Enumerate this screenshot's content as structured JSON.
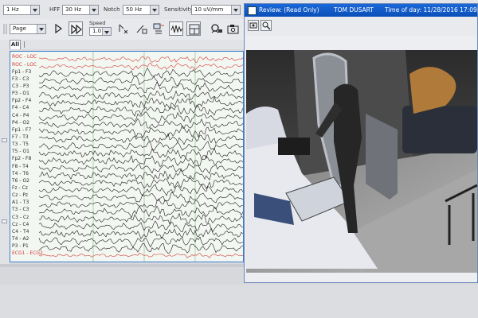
{
  "toolbar": {
    "lff": {
      "value": "1 Hz"
    },
    "hff": {
      "label": "HFF",
      "value": "30 Hz"
    },
    "notch": {
      "label": "Notch",
      "value": "50 Hz"
    },
    "sensitivity": {
      "label": "Sensitivity",
      "value": "10 uV/mm"
    }
  },
  "nav": {
    "page_label": "Page",
    "speed_label": "Speed",
    "speed_value": "1.0"
  },
  "tabs": {
    "all": "All"
  },
  "eeg": {
    "channels": [
      "ROC - LOC",
      "ROC - LOC",
      "Fp1 - F3",
      "F3 - C3",
      "C3 - P3",
      "P3 - O1",
      "Fp2 - F4",
      "F4 - C4",
      "C4 - P4",
      "P4 - O2",
      "Fp1 - F7",
      "F7 - T3",
      "T3 - T5",
      "T5 - O1",
      "Fp2 - F8",
      "F8 - T4",
      "T4 - T6",
      "T6 - O2",
      "Fz - Cz",
      "Cz - Pz",
      "A1 - T3",
      "T3 - C3",
      "C3 - Cz",
      "Cz - C4",
      "C4 - T4",
      "T4 - A2",
      "P3 - P1",
      "ECG1 - ECG2"
    ],
    "colors": {
      "trace": "#1c1c1c",
      "marker": "#e0403a",
      "grid": "#9ac69a",
      "ecg": "#d23b3b"
    }
  },
  "video": {
    "title": "Review: (Read Only)",
    "patient": "TOM DUSART",
    "time_label": "Time of day: 11/28/2016 17:09:3",
    "colors": {
      "titlebar": "#0b4fb8"
    }
  }
}
